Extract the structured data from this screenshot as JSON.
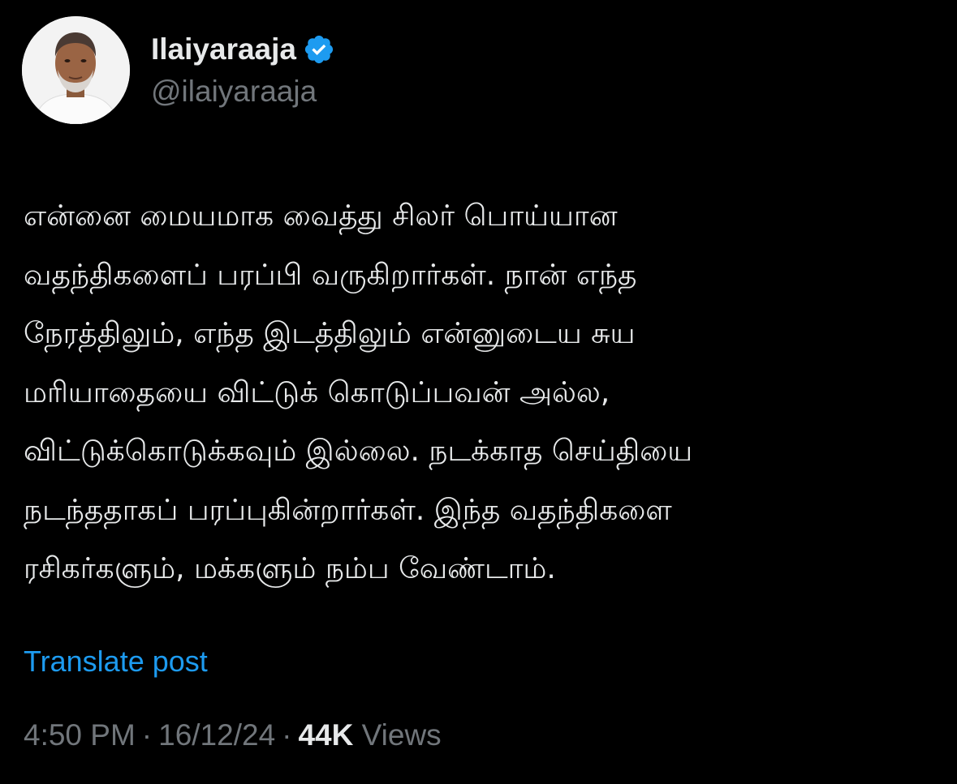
{
  "author": {
    "display_name": "Ilaiyaraaja",
    "handle": "@ilaiyaraaja",
    "verified": true,
    "avatar_icon": "profile-photo",
    "verified_icon": "verified-badge-icon",
    "verified_color": "#1d9bf0"
  },
  "post": {
    "text": "என்னை மையமாக வைத்து சிலர் பொய்யான\nவதந்திகளைப் பரப்பி வருகிறார்கள். நான் எந்த\nநேரத்திலும், எந்த இடத்திலும் என்னுடைய சுய\nமரியாதையை விட்டுக் கொடுப்பவன் அல்ல,\nவிட்டுக்கொடுக்கவும் இல்லை. நடக்காத செய்தியை\nநடந்ததாகப் பரப்புகின்றார்கள். இந்த வதந்திகளை\nரசிகர்களும், மக்களும் நம்ப வேண்டாம்.",
    "translate_label": "Translate post"
  },
  "meta": {
    "time": "4:50 PM",
    "separator": "·",
    "date": "16/12/24",
    "views_count": "44K",
    "views_label": "Views"
  },
  "colors": {
    "background": "#000000",
    "text_primary": "#e7e9ea",
    "text_secondary": "#71767b",
    "link": "#1d9bf0"
  }
}
